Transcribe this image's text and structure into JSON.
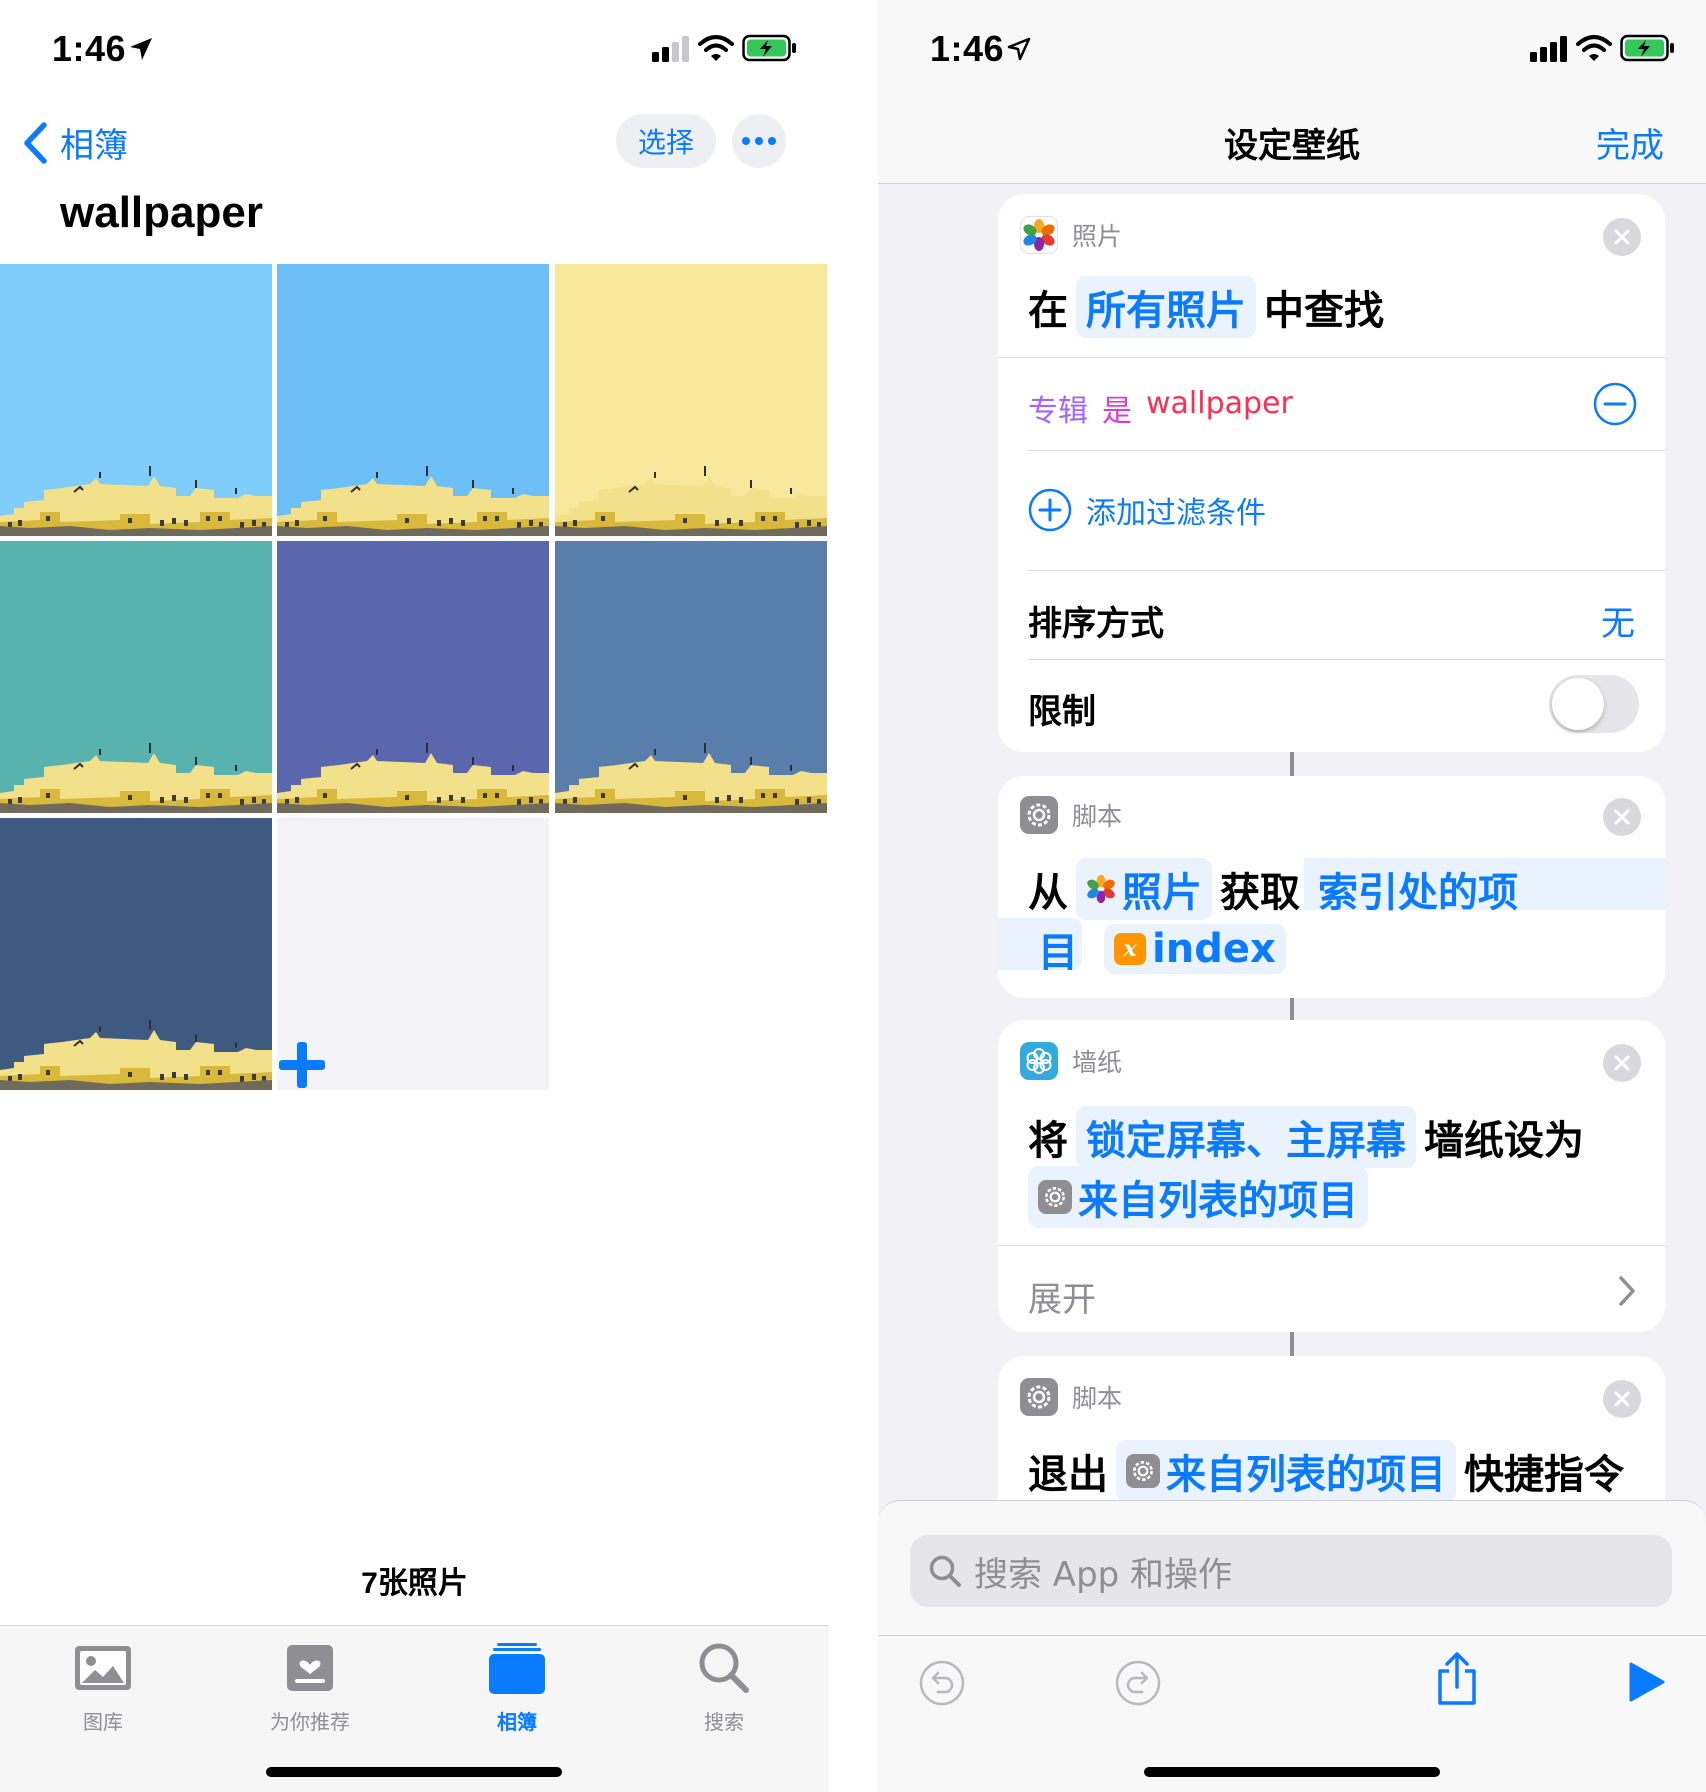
{
  "left": {
    "status": {
      "time": "1:46"
    },
    "nav": {
      "back_label": "相簿",
      "select_label": "选择",
      "more_icon": "ellipsis-icon"
    },
    "album_title": "wallpaper",
    "photos": [
      {
        "bg": "#7ecdfb"
      },
      {
        "bg": "#6cbff7"
      },
      {
        "bg": "#f8e89c"
      },
      {
        "bg": "#58b2ad"
      },
      {
        "bg": "#5a66ad"
      },
      {
        "bg": "#5a7eab"
      },
      {
        "bg": "#3e5a80"
      }
    ],
    "photo_count": "7张照片",
    "tabs": [
      {
        "label": "图库",
        "icon": "photo-library-icon"
      },
      {
        "label": "为你推荐",
        "icon": "for-you-icon"
      },
      {
        "label": "相簿",
        "icon": "albums-icon",
        "active": true
      },
      {
        "label": "搜索",
        "icon": "search-icon"
      }
    ]
  },
  "right": {
    "status": {
      "time": "1:46"
    },
    "nav": {
      "title": "设定壁纸",
      "done_label": "完成"
    },
    "find_photos": {
      "app": "照片",
      "verb": "在",
      "source": "所有照片",
      "suffix": "中查找",
      "filter": {
        "field": "专辑",
        "op": "是",
        "value": "wallpaper"
      },
      "add_filter": "添加过滤条件",
      "sort_label": "排序方式",
      "sort_value": "无",
      "limit_label": "限制",
      "limit_on": false
    },
    "get_item": {
      "app": "脚本",
      "from": "从",
      "source": "照片",
      "verb": "获取",
      "item_a": "索引处的项",
      "item_b": "目",
      "var_badge": "x",
      "var": "index"
    },
    "set_wallpaper": {
      "app": "墙纸",
      "verb": "将",
      "screens": "锁定屏幕、主屏幕",
      "middle": "墙纸设为",
      "source": "来自列表的项目",
      "expand": "展开"
    },
    "exit": {
      "app": "脚本",
      "verb": "退出",
      "source": "来自列表的项目",
      "suffix": "快捷指令"
    },
    "search_placeholder": "搜索 App 和操作",
    "accent": "#0a7aff"
  }
}
